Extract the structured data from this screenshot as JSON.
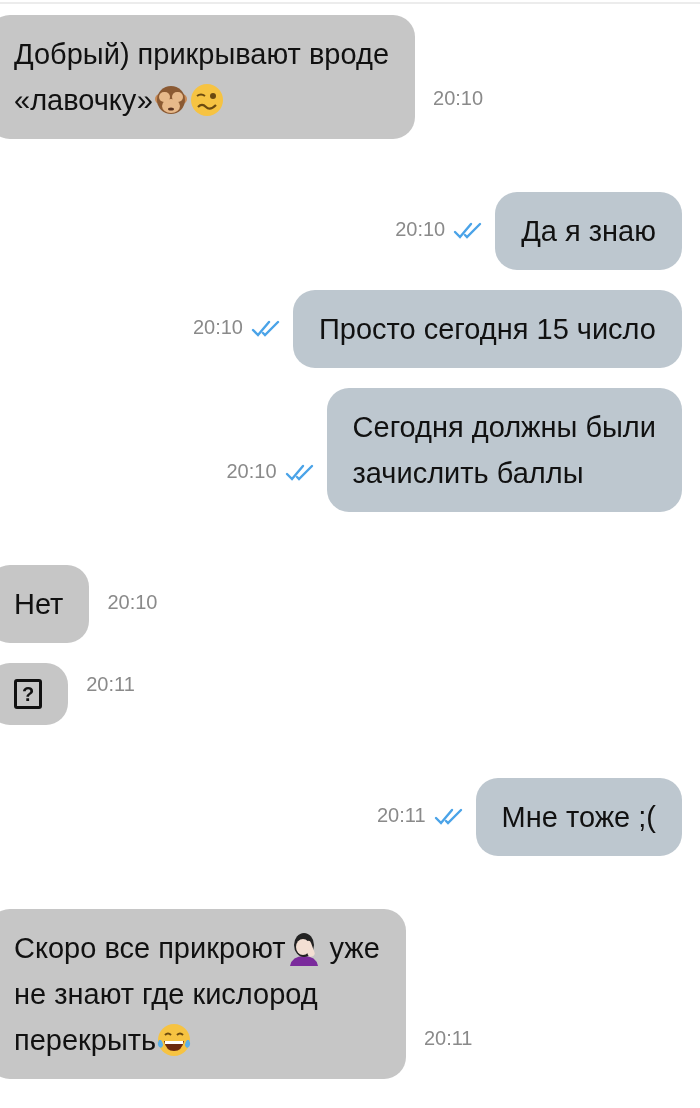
{
  "messages": [
    {
      "kind": "incoming",
      "time": "20:10",
      "lines": [
        [
          {
            "kind": "text",
            "text": "Добрый) прикрывают вроде"
          }
        ],
        [
          {
            "kind": "text",
            "text": "«лавочку»"
          },
          {
            "kind": "monkey"
          },
          {
            "kind": "woozy"
          }
        ]
      ]
    },
    {
      "kind": "outgoing",
      "time": "20:10",
      "read": true,
      "lines": [
        [
          {
            "kind": "text",
            "text": "Да я знаю"
          }
        ]
      ]
    },
    {
      "kind": "outgoing",
      "time": "20:10",
      "read": true,
      "lines": [
        [
          {
            "kind": "text",
            "text": "Просто сегодня 15 число"
          }
        ]
      ]
    },
    {
      "kind": "outgoing",
      "time": "20:10",
      "read": true,
      "lines": [
        [
          {
            "kind": "text",
            "text": "Сегодня должны были"
          }
        ],
        [
          {
            "kind": "text",
            "text": "зачислить баллы"
          }
        ]
      ]
    },
    {
      "kind": "incoming",
      "time": "20:10",
      "lines": [
        [
          {
            "kind": "text",
            "text": "Нет"
          }
        ]
      ]
    },
    {
      "kind": "incoming",
      "time": "20:11",
      "lines": [
        [
          {
            "kind": "missing",
            "text": "?"
          }
        ]
      ]
    },
    {
      "kind": "outgoing",
      "time": "20:11",
      "read": true,
      "lines": [
        [
          {
            "kind": "text",
            "text": "Мне тоже ;("
          }
        ]
      ]
    },
    {
      "kind": "incoming",
      "time": "20:11",
      "lines": [
        [
          {
            "kind": "text",
            "text": "Скоро все прикроют"
          },
          {
            "kind": "facepalm"
          },
          {
            "kind": "text",
            "text": "уже"
          }
        ],
        [
          {
            "kind": "text",
            "text": "не знают где кислород"
          }
        ],
        [
          {
            "kind": "text",
            "text": "перекрыть"
          },
          {
            "kind": "laughing"
          }
        ]
      ]
    }
  ]
}
